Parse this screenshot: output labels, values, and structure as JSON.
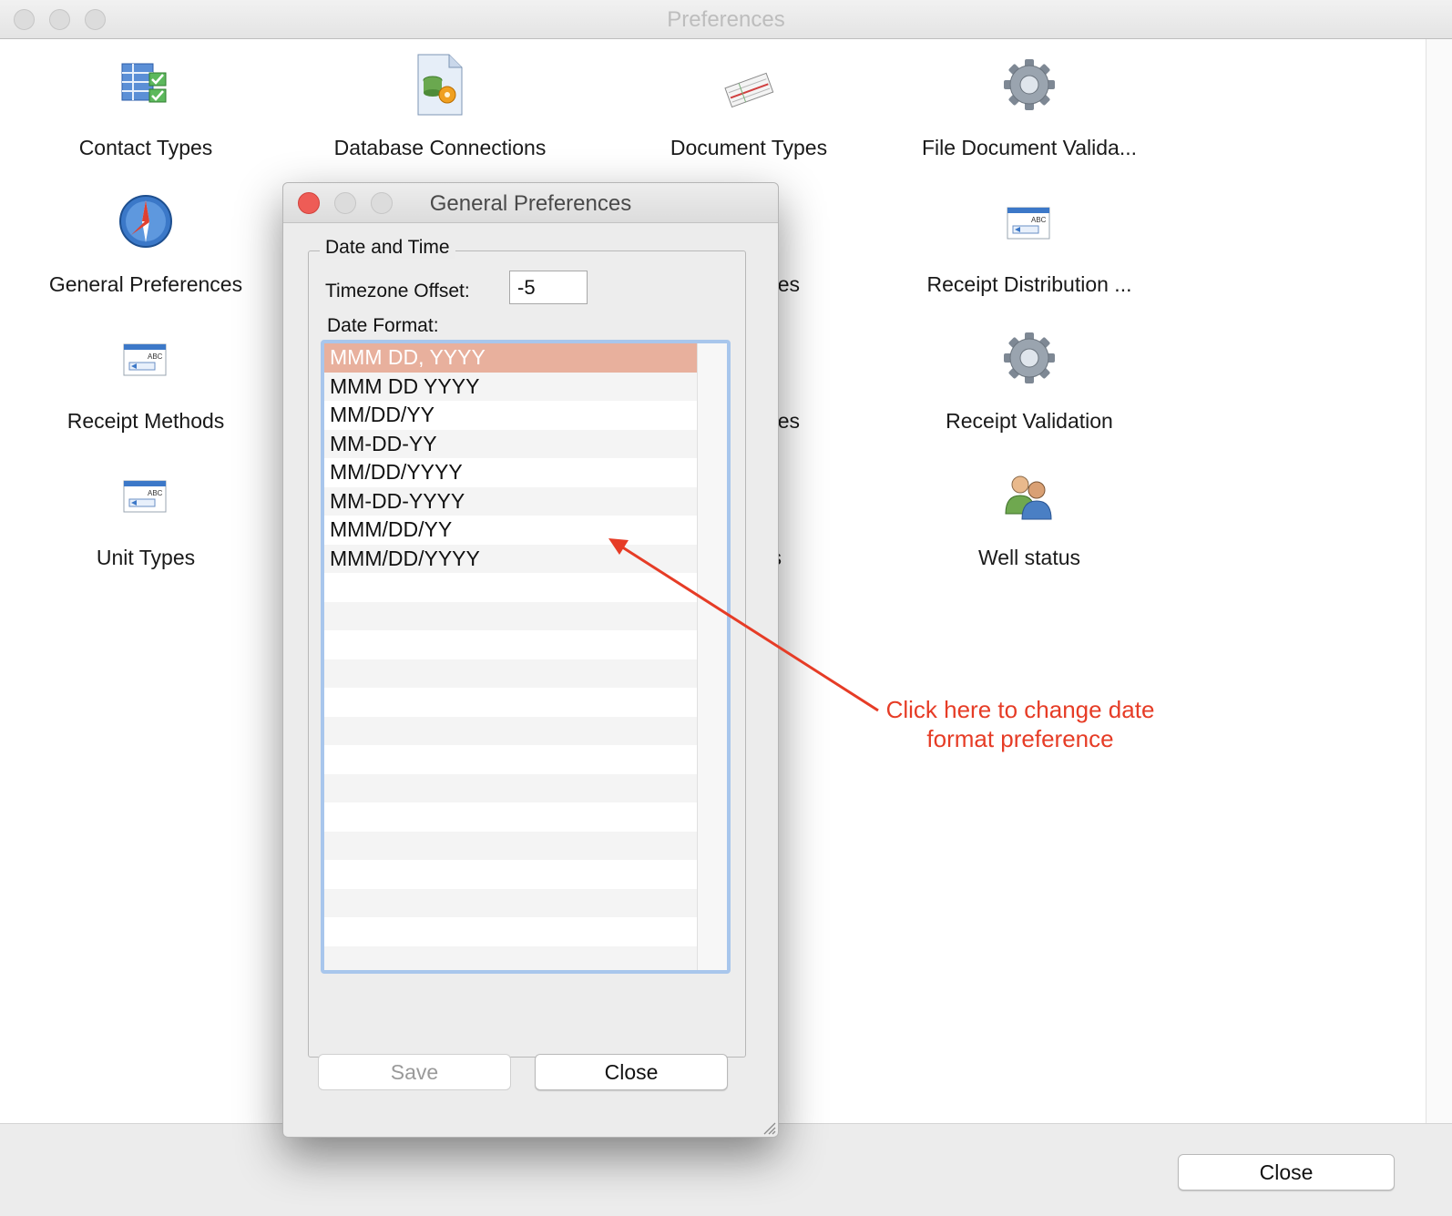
{
  "main_window": {
    "title": "Preferences",
    "close_label": "Close",
    "items": [
      {
        "label": "Contact Types",
        "icon": "contact-types-icon"
      },
      {
        "label": "Database Connections",
        "icon": "database-icon"
      },
      {
        "label": "Document Types",
        "icon": "document-types-icon"
      },
      {
        "label": "File Document Valida...",
        "icon": "gear-icon"
      },
      {
        "label": "General Preferences",
        "icon": "compass-icon"
      },
      {
        "label": "ypes",
        "icon": ""
      },
      {
        "label": "Receipt Distribution ...",
        "icon": "abc-form-icon"
      },
      {
        "label": "Receipt Methods",
        "icon": "abc-form-icon"
      },
      {
        "label": "ypes",
        "icon": ""
      },
      {
        "label": "Receipt Validation",
        "icon": "gear-icon"
      },
      {
        "label": "Unit Types",
        "icon": "abc-form-icon"
      },
      {
        "label": "s",
        "icon": ""
      },
      {
        "label": "Well status",
        "icon": "users-icon"
      }
    ]
  },
  "dialog": {
    "title": "General Preferences",
    "group_title": "Date and Time",
    "timezone_label": "Timezone Offset:",
    "timezone_value": "-5",
    "date_format_label": "Date Format:",
    "date_formats": [
      "MMM DD, YYYY",
      "MMM DD YYYY",
      "MM/DD/YY",
      "MM-DD-YY",
      "MM/DD/YYYY",
      "MM-DD-YYYY",
      "MMM/DD/YY",
      "MMM/DD/YYYY"
    ],
    "selected_index": 0,
    "save_label": "Save",
    "close_label": "Close"
  },
  "annotation": {
    "line1": "Click here to change date",
    "line2": "format preference",
    "color": "#e63c26"
  },
  "colors": {
    "selection": "#e8b09d",
    "focus_ring": "#a8c6ec",
    "traffic_close": "#ee5c56"
  }
}
